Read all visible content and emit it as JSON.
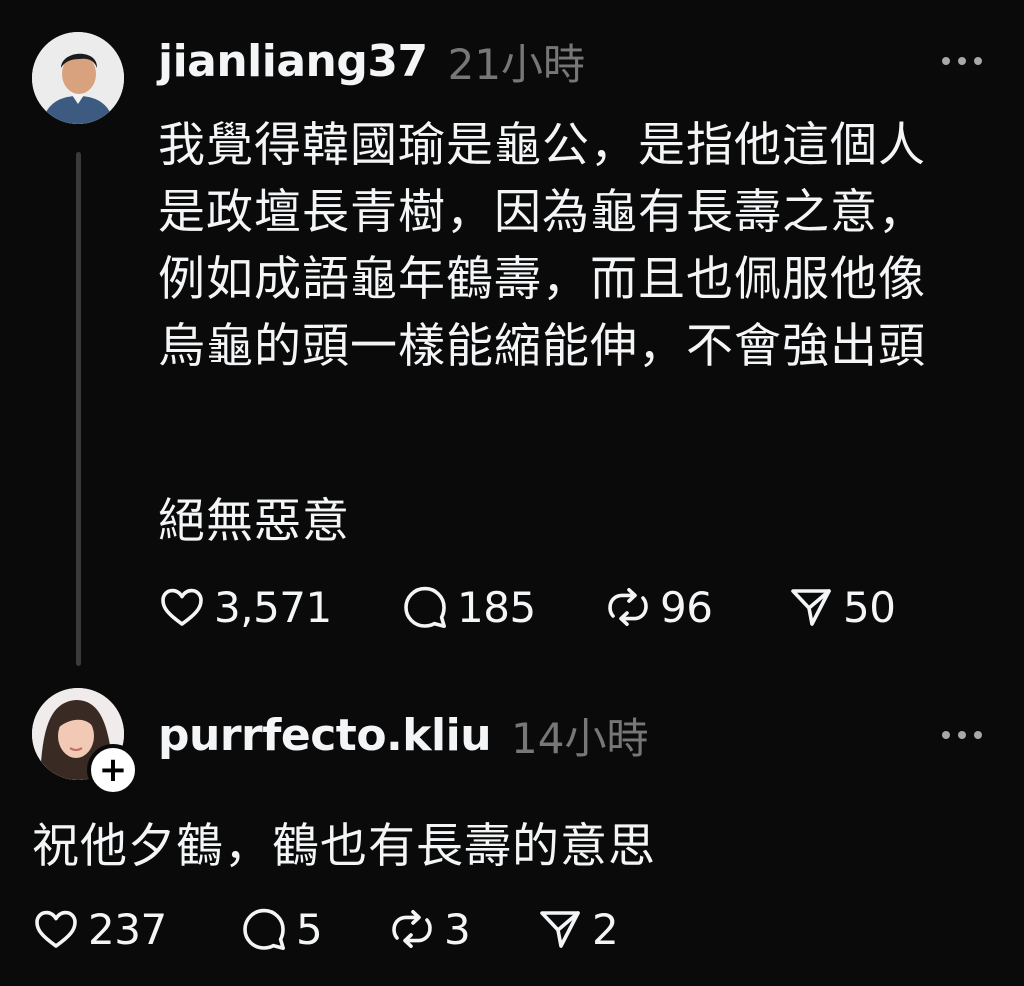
{
  "post": {
    "username": "jianliang37",
    "time": "21小時",
    "paragraph1": "我覺得韓國瑜是龜公，是指他這個人是政壇長青樹，因為龜有長壽之意，例如成語龜年鶴壽，而且也佩服他像烏龜的頭一樣能縮能伸，不會強出頭",
    "paragraph2": "絕無惡意",
    "likes": "3,571",
    "comments": "185",
    "reposts": "96",
    "shares": "50"
  },
  "reply": {
    "username": "purrfecto.kliu",
    "time": "14小時",
    "text": "祝他夕鶴，鶴也有長壽的意思",
    "follow_symbol": "+",
    "likes": "237",
    "comments": "5",
    "reposts": "3",
    "shares": "2"
  },
  "icons": {
    "like": "heart-icon",
    "comment": "comment-bubble-icon",
    "repost": "repost-icon",
    "share": "send-icon",
    "more": "more-dots-icon",
    "follow": "plus-icon"
  }
}
